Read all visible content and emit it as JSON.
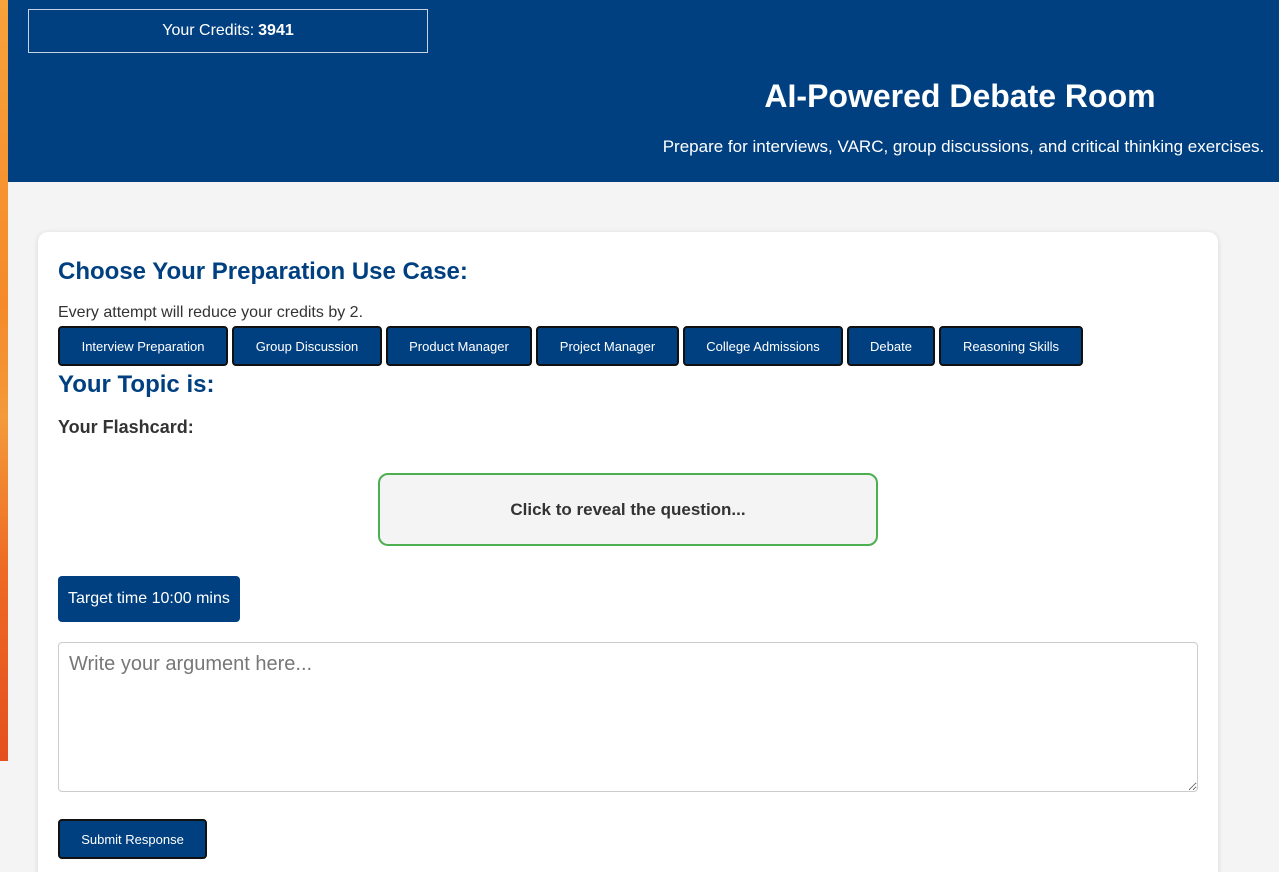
{
  "header": {
    "credits_label": "Your Credits:",
    "credits_value": "3941",
    "title": "AI-Powered Debate Room",
    "subtitle": "Prepare for interviews, VARC, group discussions, and critical thinking exercises."
  },
  "main": {
    "section_title": "Choose Your Preparation Use Case:",
    "credit_note": "Every attempt will reduce your credits by 2.",
    "use_cases": [
      {
        "label": "Interview Preparation"
      },
      {
        "label": "Group Discussion"
      },
      {
        "label": "Product Manager"
      },
      {
        "label": "Project Manager"
      },
      {
        "label": "College Admissions"
      },
      {
        "label": "Debate"
      },
      {
        "label": "Reasoning Skills"
      }
    ],
    "topic_title": "Your Topic is:",
    "flashcard_label": "Your Flashcard:",
    "flashcard_text": "Click to reveal the question...",
    "timer_text": "Target time 10:00 mins",
    "argument_placeholder": "Write your argument here...",
    "argument_value": "",
    "submit_label": "Submit Response"
  },
  "colors": {
    "primary": "#004080",
    "flashcard_border": "#4caf50",
    "background": "#f4f4f4"
  }
}
